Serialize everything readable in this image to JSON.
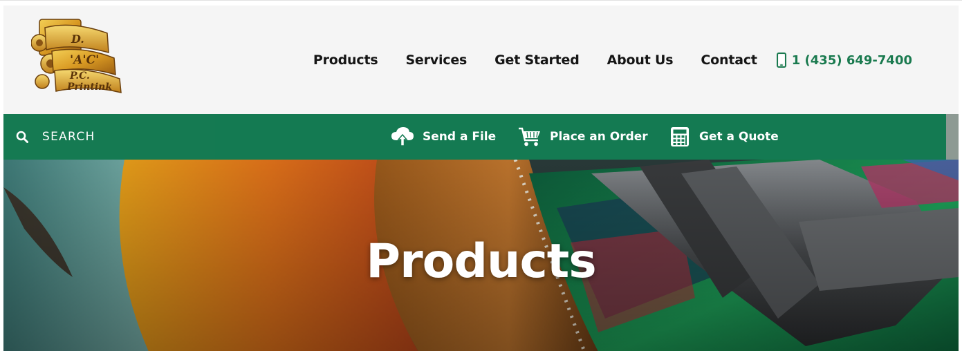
{
  "header": {
    "logo": {
      "icon": "printing-press-logo",
      "text_lines": [
        "D.",
        "'A'C'",
        "P.C.",
        "Printink"
      ]
    },
    "nav": [
      {
        "label": "Products"
      },
      {
        "label": "Services"
      },
      {
        "label": "Get Started"
      },
      {
        "label": "About Us"
      },
      {
        "label": "Contact"
      }
    ],
    "phone": {
      "icon": "mobile-phone-icon",
      "label": "1 (435) 649-7400"
    }
  },
  "actionbar": {
    "search": {
      "icon": "search-icon",
      "label": "SEARCH"
    },
    "actions": [
      {
        "icon": "cloud-upload-icon",
        "label": "Send a File"
      },
      {
        "icon": "shopping-cart-icon",
        "label": "Place an Order"
      },
      {
        "icon": "calculator-icon",
        "label": "Get a Quote"
      }
    ]
  },
  "hero": {
    "title": "Products"
  },
  "colors": {
    "brand_green": "#147a52",
    "header_bg": "#f5f5f5",
    "nav_text": "#151515",
    "phone_text": "#1a7a4f"
  }
}
